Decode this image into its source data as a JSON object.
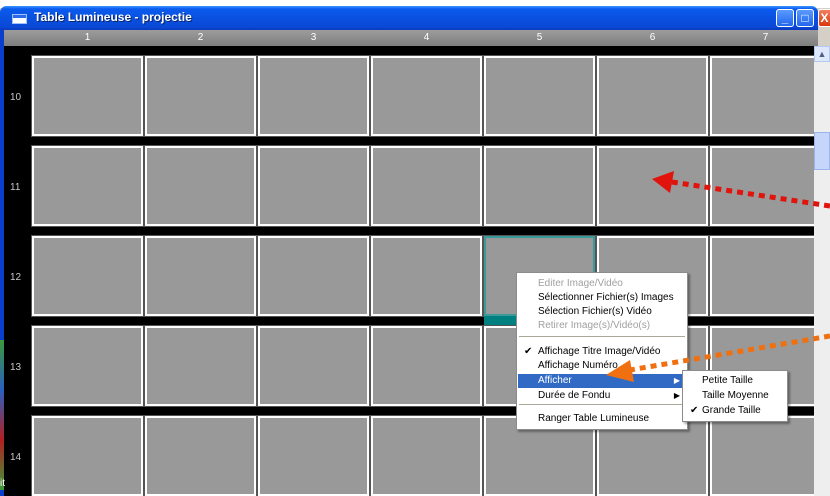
{
  "window": {
    "title": "Table Lumineuse - projectie",
    "minimize_glyph": "_",
    "maximize_glyph": "□",
    "close_glyph": "X"
  },
  "columns": [
    "1",
    "2",
    "3",
    "4",
    "5",
    "6",
    "7"
  ],
  "rows": [
    "10",
    "11",
    "12",
    "13",
    "14"
  ],
  "selected_cell": {
    "row": "12",
    "column": "5"
  },
  "context_menu": {
    "items": [
      {
        "label": "Editer Image/Vidéo",
        "disabled": true
      },
      {
        "label": "Sélectionner Fichier(s) Images",
        "disabled": false
      },
      {
        "label": "Sélection Fichier(s) Vidéo",
        "disabled": false
      },
      {
        "label": "Retirer Image(s)/Vidéo(s)",
        "disabled": true
      },
      {
        "label": "Affichage Titre Image/Vidéo",
        "checked": true
      },
      {
        "label": "Affichage Numéro",
        "checked": false
      },
      {
        "label": "Afficher",
        "highlighted": true,
        "submenu": true
      },
      {
        "label": "Durée de Fondu",
        "submenu": true
      },
      {
        "label": "Ranger Table Lumineuse"
      }
    ],
    "submenu_arrow_glyph": "▶",
    "check_glyph": "✔"
  },
  "submenu": {
    "items": [
      {
        "label": "Petite Taille",
        "checked": false
      },
      {
        "label": "Taille Moyenne",
        "checked": false
      },
      {
        "label": "Grande Taille",
        "checked": true
      }
    ]
  },
  "background_edge_text": "it",
  "colors": {
    "cell_bg": "#999999",
    "cell_border": "#ffffff",
    "selection_teal": "#008080",
    "menu_highlight": "#316ac5",
    "titlebar_blue": "#0a51e0",
    "arrow_red": "#e0140c",
    "arrow_orange": "#f07010"
  },
  "icons": {
    "app": "window-app-icon",
    "minimize": "minimize-icon",
    "maximize": "maximize-icon",
    "close": "close-icon",
    "scroll_up": "chevron-up-icon"
  }
}
